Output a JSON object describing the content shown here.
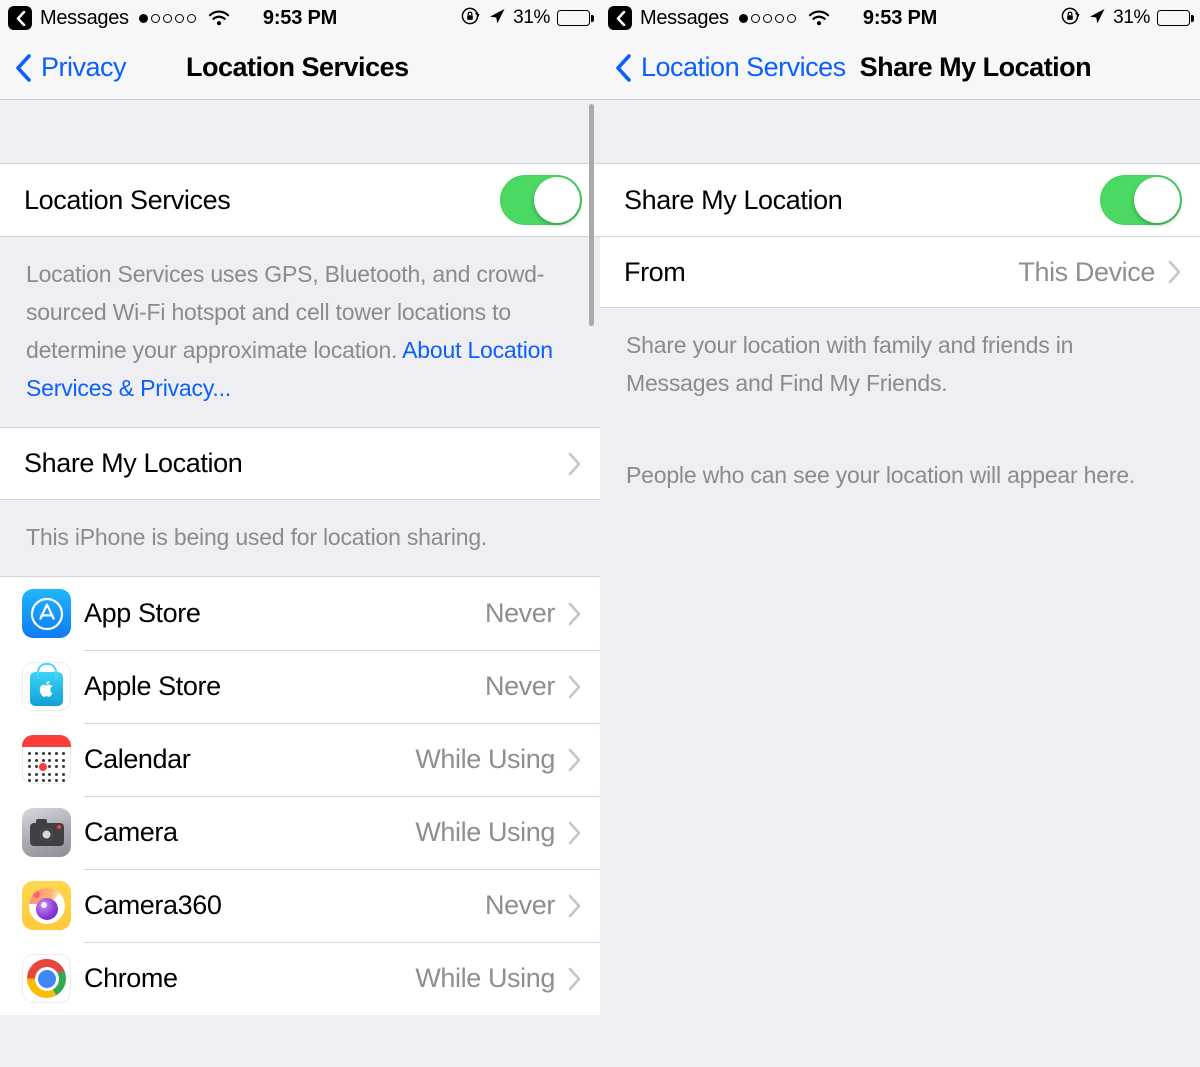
{
  "statusbar": {
    "back_app": "Messages",
    "back_icon": "chevron-left-badge-icon",
    "signal_dots_filled": 1,
    "signal_dots_total": 5,
    "wifi_icon": "wifi-icon",
    "time": "9:53 PM",
    "rotation_lock_icon": "rotation-lock-icon",
    "location_arrow_icon": "location-arrow-icon",
    "battery_percent": "31%",
    "battery_level": 31
  },
  "left_panel": {
    "nav": {
      "back_icon": "chevron-left-icon",
      "back_label": "Privacy",
      "title": "Location Services"
    },
    "section_master": {
      "row_label": "Location Services",
      "toggle_name": "location-services-toggle",
      "toggle_on": true,
      "footer_text": "Location Services uses GPS, Bluetooth, and crowd-sourced Wi-Fi hotspot and cell tower locations to determine your approximate location. ",
      "footer_link": "About Location Services & Privacy..."
    },
    "section_share": {
      "row_label": "Share My Location",
      "chevron_icon": "chevron-right-icon",
      "footer_text": "This iPhone is being used for location sharing."
    },
    "apps": [
      {
        "name": "App Store",
        "value": "Never",
        "icon": "app-store-icon",
        "chevron_icon": "chevron-right-icon"
      },
      {
        "name": "Apple Store",
        "value": "Never",
        "icon": "apple-store-icon",
        "chevron_icon": "chevron-right-icon"
      },
      {
        "name": "Calendar",
        "value": "While Using",
        "icon": "calendar-icon",
        "chevron_icon": "chevron-right-icon"
      },
      {
        "name": "Camera",
        "value": "While Using",
        "icon": "camera-icon",
        "chevron_icon": "chevron-right-icon"
      },
      {
        "name": "Camera360",
        "value": "Never",
        "icon": "camera360-icon",
        "chevron_icon": "chevron-right-icon"
      },
      {
        "name": "Chrome",
        "value": "While Using",
        "icon": "chrome-icon",
        "chevron_icon": "chevron-right-icon"
      }
    ]
  },
  "right_panel": {
    "nav": {
      "back_icon": "chevron-left-icon",
      "back_label": "Location Services",
      "title": "Share My Location"
    },
    "rows": {
      "share_label": "Share My Location",
      "share_toggle_name": "share-my-location-toggle",
      "share_toggle_on": true,
      "from_label": "From",
      "from_value": "This Device",
      "from_chevron_icon": "chevron-right-icon"
    },
    "footer_1": "Share your location with family and friends in Messages and Find My Friends.",
    "footer_2": "People who can see your location will appear here."
  },
  "colors": {
    "accent_blue": "#0a60ff",
    "toggle_green": "#4bd863",
    "value_gray": "#8e8e93",
    "footer_gray": "#8a8a8f",
    "group_bg": "#efeef3",
    "cell_bg": "#ffffff"
  }
}
